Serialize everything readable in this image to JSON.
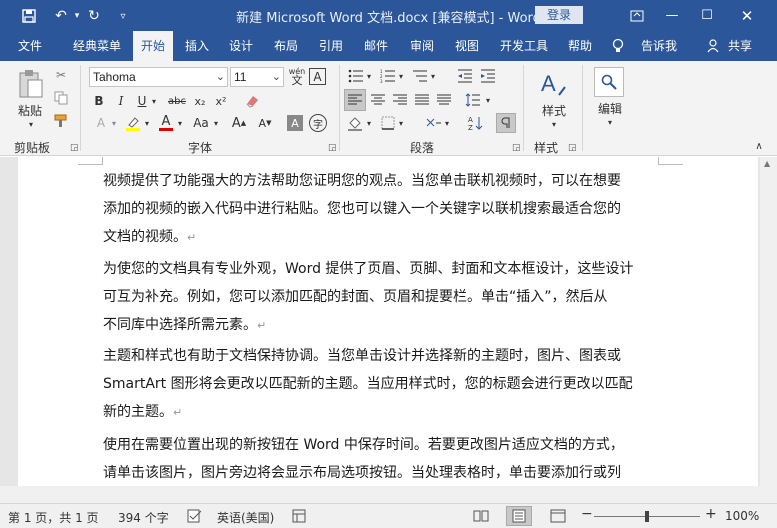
{
  "titlebar": {
    "title": "新建 Microsoft Word 文档.docx [兼容模式]  -  Word",
    "login": "登录"
  },
  "tabs": [
    "文件",
    "经典菜单",
    "开始",
    "插入",
    "设计",
    "布局",
    "引用",
    "邮件",
    "审阅",
    "视图",
    "开发工具",
    "帮助",
    "告诉我",
    "共享"
  ],
  "active_tab": "开始",
  "ribbon": {
    "clipboard": {
      "paste_label": "粘贴",
      "group_label": "剪贴板"
    },
    "font": {
      "font_name": "Tahoma",
      "font_size": "11",
      "group_label": "字体",
      "wen_label": "wén"
    },
    "paragraph": {
      "group_label": "段落"
    },
    "styles": {
      "label": "样式",
      "group_label": "样式"
    },
    "editing": {
      "label": "编辑"
    }
  },
  "document": {
    "paragraphs": [
      [
        "视频提供了功能强大的方法帮助您证明您的观点。当您单击联机视频时，可以在想要",
        "添加的视频的嵌入代码中进行粘贴。您也可以键入一个关键字以联机搜索最适合您的",
        "文档的视频。"
      ],
      [
        "为使您的文档具有专业外观，Word 提供了页眉、页脚、封面和文本框设计，这些设计",
        "可互为补充。例如，您可以添加匹配的封面、页眉和提要栏。单击“插入”，然后从",
        "不同库中选择所需元素。"
      ],
      [
        "主题和样式也有助于文档保持协调。当您单击设计并选择新的主题时，图片、图表或",
        "SmartArt 图形将会更改以匹配新的主题。当应用样式时，您的标题会进行更改以匹配",
        "新的主题。"
      ],
      [
        "使用在需要位置出现的新按钮在 Word 中保存时间。若要更改图片适应文档的方式，",
        "请单击该图片，图片旁边将会显示布局选项按钮。当处理表格时，单击要添加行或列"
      ]
    ],
    "return_mark": "↵"
  },
  "status": {
    "page": "第 1 页，共 1 页",
    "words": "394 个字",
    "language": "英语(美国)",
    "zoom": "100%",
    "zoom_level": 1.0
  },
  "colors": {
    "brand": "#2b579a",
    "ribbon_bg": "#f3f3f3",
    "highlight": "#ffff00",
    "font_color": "#e00000"
  }
}
